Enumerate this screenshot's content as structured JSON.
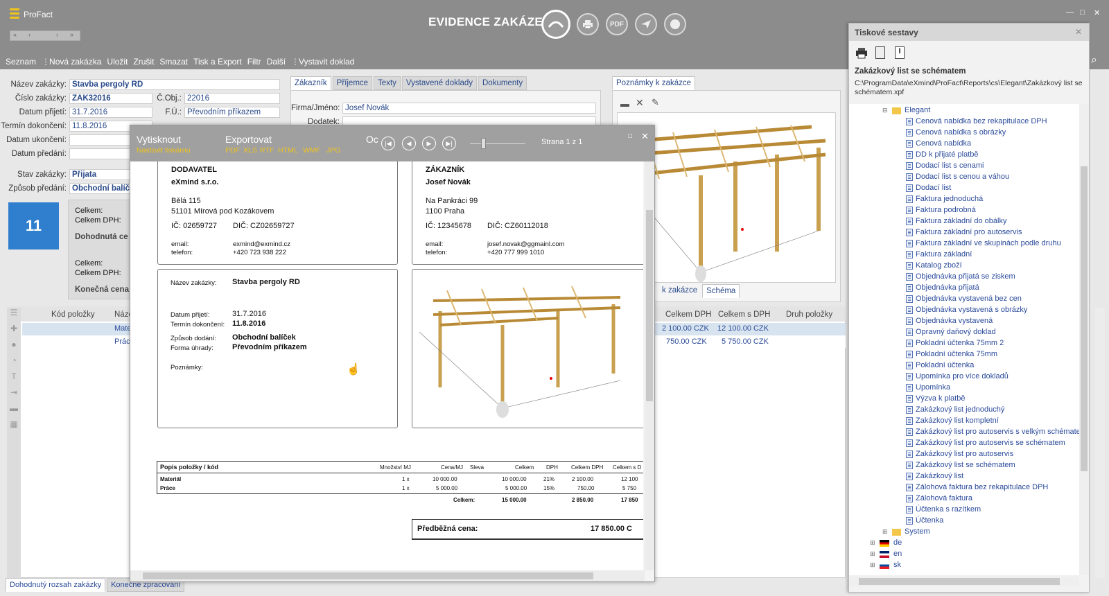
{
  "app": {
    "name": "ProFact",
    "title": "EVIDENCE ZAKÁZEK",
    "accent": "#f0c41b"
  },
  "toolbar_icons": [
    "refresh-icon",
    "print-icon",
    "pdf-icon",
    "send-icon",
    "record-icon"
  ],
  "toolbar_pdf": "PDF",
  "nav": {
    "first": "«",
    "prev": "‹",
    "next": "›",
    "last": "»"
  },
  "menu": [
    "Seznam",
    "Nová zakázka",
    "Uložit",
    "Zrušit",
    "Smazat",
    "Tisk a Export",
    "Filtr",
    "Další",
    "Vystavit doklad"
  ],
  "form": {
    "nazev_label": "Název zakázky:",
    "nazev": "Stavba pergoly RD",
    "cislo_label": "Číslo zakázky:",
    "cislo": "ZAK32016",
    "cobj_label": "Č.Obj.:",
    "cobj": "22016",
    "prijeti_label": "Datum přijetí:",
    "prijeti": "31.7.2016",
    "fu_label": "F.Ú.:",
    "fu": "Převodním příkazem",
    "termin_label": "Termín dokončení:",
    "termin": "11.8.2016",
    "ukonceni_label": "Datum ukončení:",
    "predani_label": "Datum předání:",
    "stav_label": "Stav zakázky:",
    "stav": "Přijata",
    "zpusob_label": "Způsob předání:",
    "zpusob": "Obchodní balíč",
    "number": "11",
    "celkem": "Celkem:",
    "celkem_dph": "Celkem DPH:",
    "dohodnuta": "Dohodnutá ce",
    "celkem2": "Celkem:",
    "celkem_dph2": "Celkem DPH:",
    "konecna": "Konečná cena"
  },
  "tabs": [
    "Zákazník",
    "Příjemce",
    "Texty",
    "Vystavené doklady",
    "Dokumenty"
  ],
  "customer": {
    "firma_label": "Firma/Jméno:",
    "firma": "Josef Novák",
    "dodatek_label": "Dodatek:"
  },
  "notes": {
    "tab": "Poznámky k zakázce",
    "tab2": "k zakázce",
    "tab3": "Schéma"
  },
  "grid": {
    "headers": [
      "Kód položky",
      "Náze",
      "Celkem DPH",
      "Celkem s DPH",
      "Druh položky"
    ],
    "rows": [
      {
        "name": "Mate",
        "dph": "2 100.00 CZK",
        "sdph": "12 100.00 CZK"
      },
      {
        "name": "Prác",
        "dph": "750.00 CZK",
        "sdph": "5 750.00 CZK"
      }
    ]
  },
  "bottom_tabs": [
    "Dohodnutý rozsah zakázky",
    "Konečné zpracování"
  ],
  "print": {
    "print": "Vytisknout",
    "printer": "Nastavit tiskárnu",
    "export": "Exportovat",
    "formats": [
      "PDF",
      "XLS",
      "RTF",
      "HTML",
      "WMF",
      "JPG"
    ],
    "oc": "Oc",
    "page": "Strana 1 z 1",
    "dod_title": "DODAVATEL",
    "dod_name": "eXmind s.r.o.",
    "dod_street": "Bělá 115",
    "dod_city": "51101  Mírová pod Kozákovem",
    "dod_ic": "IČ: 02659727",
    "dod_dic": "DIČ: CZ02659727",
    "email_label": "email:",
    "phone_label": "telefon:",
    "dod_email": "exmind@exmind.cz",
    "dod_phone": "+420 723 938 222",
    "zak_title": "ZÁKAZNÍK",
    "zak_name": "Josef Novák",
    "zak_street": "Na Pankráci 99",
    "zak_city": "1100  Praha",
    "zak_ic": "IČ: 12345678",
    "zak_dic": "DIČ: CZ60112018",
    "zak_email": "josef.novak@ggmainl.com",
    "zak_phone": "+420 777 999 1010",
    "nazev_label": "Název zakázky:",
    "nazev": "Stavba pergoly RD",
    "prijeti_label": "Datum přijetí:",
    "prijeti": "31.7.2016",
    "termin_label": "Termín dokončení:",
    "termin": "11.8.2016",
    "zpusob_label": "Způsob dodání:",
    "zpusob": "Obchodní balíček",
    "forma_label": "Forma úhrady:",
    "forma": "Převodním příkazem",
    "pozn_label": "Poznámky:",
    "tbl_headers": [
      "Popis položky / kód",
      "Množství MJ",
      "Cena/MJ",
      "Sleva",
      "Celkem",
      "DPH",
      "Celkem DPH",
      "Celkem s D"
    ],
    "tbl_rows": [
      [
        "Materiál",
        "1 x",
        "10 000.00",
        "",
        "10 000.00",
        "21%",
        "2 100.00",
        "12 100"
      ],
      [
        "Práce",
        "1 x",
        "5 000.00",
        "",
        "5 000.00",
        "15%",
        "750.00",
        "5 750"
      ]
    ],
    "sum_label": "Celkem:",
    "sum": [
      "15 000.00",
      "2 850.00",
      "17 850"
    ],
    "pred_label": "Předběžná cena:",
    "pred": "17 850.00 C"
  },
  "reports": {
    "title": "Tiskové sestavy",
    "current": "Zakázkový list se schématem",
    "path": "C:\\ProgramData\\eXmind\\ProFact\\Reports\\cs\\Elegant\\Zakázkový list se schématem.xpf",
    "folder": "Elegant",
    "items": [
      "Cenová nabídka bez rekapitulace DPH",
      "Cenová nabídka s obrázky",
      "Cenová nabídka",
      "DD k přijaté platbě",
      "Dodací list s cenami",
      "Dodací list s cenou a váhou",
      "Dodací list",
      "Faktura jednoduchá",
      "Faktura podrobná",
      "Faktura základní do obálky",
      "Faktura základní pro autoservis",
      "Faktura základní ve skupinách podle druhu",
      "Faktura základní",
      "Katalog zboží",
      "Objednávka přijatá se ziskem",
      "Objednávka přijatá",
      "Objednávka vystavená bez cen",
      "Objednávka vystavená s obrázky",
      "Objednávka vystavená",
      "Opravný daňový doklad",
      "Pokladní účtenka 75mm 2",
      "Pokladní účtenka 75mm",
      "Pokladní účtenka",
      "Upomínka pro více dokladů",
      "Upomínka",
      "Výzva k platbě",
      "Zakázkový list jednoduchý",
      "Zakázkový list kompletní",
      "Zakázkový list pro autoservis s velkým schématem",
      "Zakázkový list pro autoservis se schématem",
      "Zakázkový list pro autoservis",
      "Zakázkový list se schématem",
      "Zakázkový list",
      "Zálohová faktura bez rekapitulace DPH",
      "Zálohová faktura",
      "Účtenka s razítkem",
      "Účtenka"
    ],
    "system": "System",
    "langs": [
      "de",
      "en",
      "sk"
    ]
  }
}
